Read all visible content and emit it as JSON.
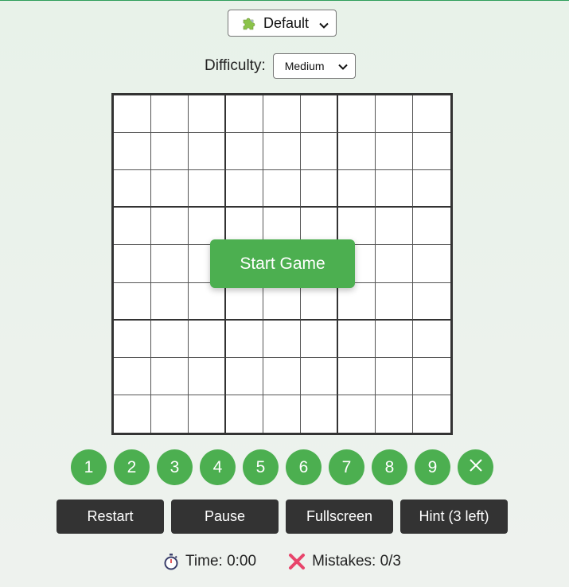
{
  "theme_select": {
    "selected": "Default",
    "icon": "puzzle-piece-icon"
  },
  "difficulty": {
    "label": "Difficulty:",
    "selected": "Medium"
  },
  "board": {
    "rows": 9,
    "cols": 9
  },
  "overlay": {
    "start_label": "Start Game"
  },
  "numpad": {
    "numbers": [
      "1",
      "2",
      "3",
      "4",
      "5",
      "6",
      "7",
      "8",
      "9"
    ],
    "erase_icon": "close-icon"
  },
  "controls": {
    "restart": "Restart",
    "pause": "Pause",
    "fullscreen": "Fullscreen",
    "hint": "Hint (3 left)"
  },
  "status": {
    "time": "Time: 0:00",
    "mistakes": "Mistakes: 0/3"
  },
  "colors": {
    "accent": "#4caf50",
    "dark_button": "#333333",
    "background": "#e8f2e9"
  }
}
